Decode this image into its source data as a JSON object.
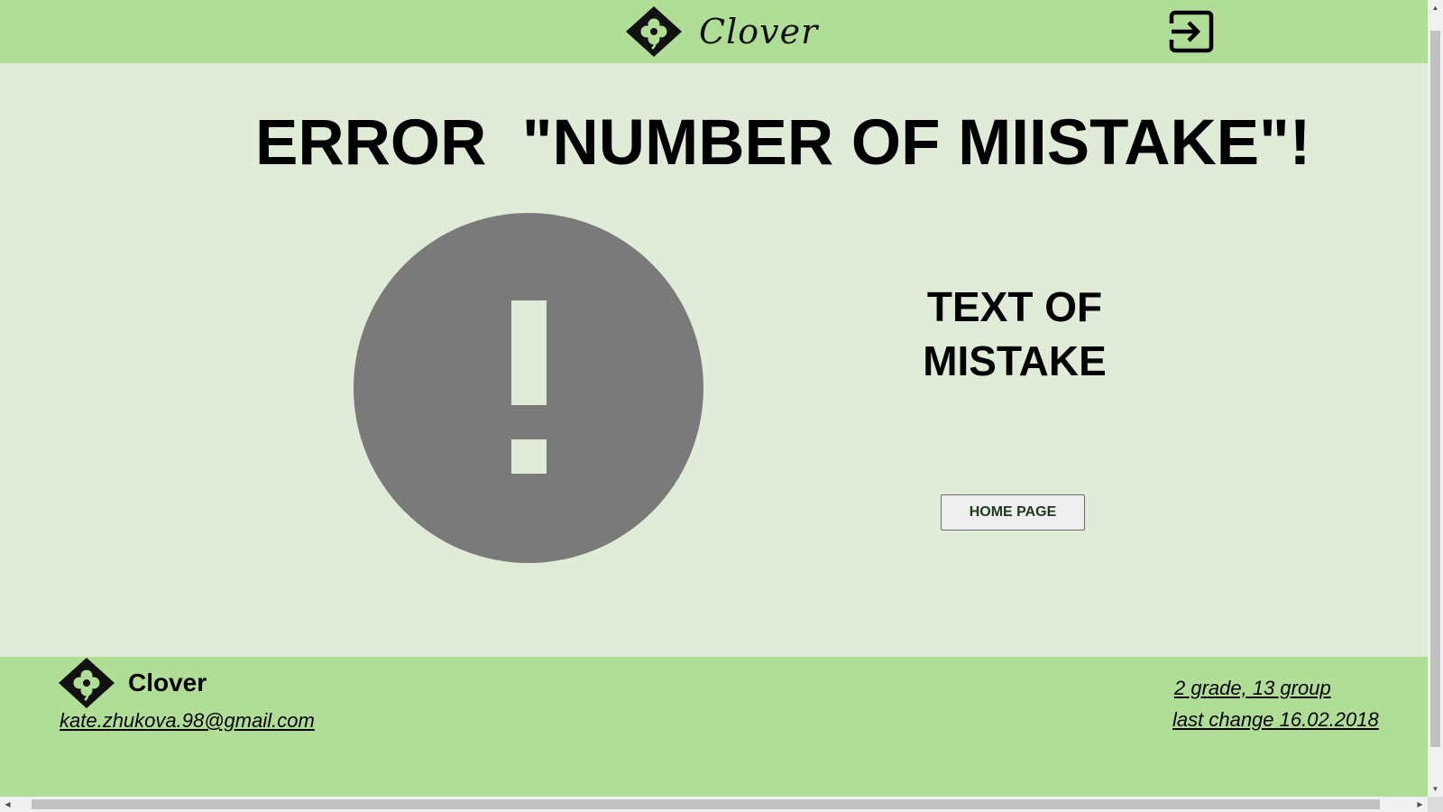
{
  "header": {
    "brand_name": "Clover",
    "logo_icon": "clover-logo-icon",
    "login_icon": "sign-in-icon"
  },
  "main": {
    "error_title": "ERROR  \"NUMBER OF MIISTAKE\"!",
    "alert_icon": "exclamation-circle-icon",
    "mistake_text_line1": "TEXT OF",
    "mistake_text_line2": "MISTAKE",
    "home_button_label": "HOME PAGE"
  },
  "footer": {
    "brand_name": "Clover",
    "email": "kate.zhukova.98@gmail.com",
    "grade_group": "2 grade, 13 group",
    "last_change": "last change 16.02.2018"
  },
  "colors": {
    "bar_green": "#b0de96",
    "page_bg": "#e0ecd8",
    "icon_gray": "#7a7a7a"
  }
}
